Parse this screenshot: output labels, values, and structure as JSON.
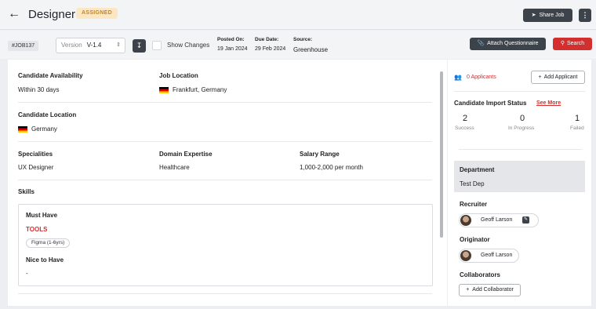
{
  "header": {
    "title": "Designer",
    "status_badge": "ASSIGNED",
    "share_label": "Share Job",
    "more_label": "⋮"
  },
  "toolbar": {
    "job_id": "#JOB137",
    "version_label": "Version",
    "version_value": "V-1.4",
    "show_changes_label": "Show Changes",
    "posted_on_label": "Posted On:",
    "posted_on_value": "19 Jan 2024",
    "due_date_label": "Due Date:",
    "due_date_value": "29 Feb 2024",
    "source_label": "Source:",
    "source_value": "Greenhouse",
    "attach_label": "Attach Questionnaire",
    "search_label": "Search"
  },
  "details": {
    "availability_label": "Candidate Availability",
    "availability_value": "Within 30 days",
    "job_location_label": "Job Location",
    "job_location_value": "Frankfurt, Germany",
    "candidate_location_label": "Candidate Location",
    "candidate_location_value": "Germany",
    "specialities_label": "Specialities",
    "specialities_value": "UX Designer",
    "domain_label": "Domain Expertise",
    "domain_value": "Healthcare",
    "salary_label": "Salary Range",
    "salary_value": "1,000-2,000 per month"
  },
  "skills": {
    "title": "Skills",
    "must_have_label": "Must Have",
    "category": "TOOLS",
    "chip": "Figma (1-6yrs)",
    "nice_to_have_label": "Nice to Have",
    "nice_to_have_value": "-"
  },
  "sidebar": {
    "applicants_label": "0 Applicants",
    "add_applicant_label": "Add Applicant",
    "import_status_label": "Candidate Import Status",
    "see_more_label": "See More",
    "stats": [
      {
        "value": "2",
        "label": "Success"
      },
      {
        "value": "0",
        "label": "In Progress"
      },
      {
        "value": "1",
        "label": "Failed"
      }
    ],
    "department_label": "Department",
    "department_value": "Test Dep",
    "recruiter_label": "Recruiter",
    "recruiter_name": "Geoff Larson",
    "originator_label": "Originator",
    "originator_name": "Geoff Larson",
    "collaborators_label": "Collaborators",
    "add_collaborator_label": "Add Collaborator"
  },
  "colors": {
    "accent_red": "#d32f2f",
    "dark_button": "#3d434a",
    "badge_bg": "#fde7c2"
  }
}
